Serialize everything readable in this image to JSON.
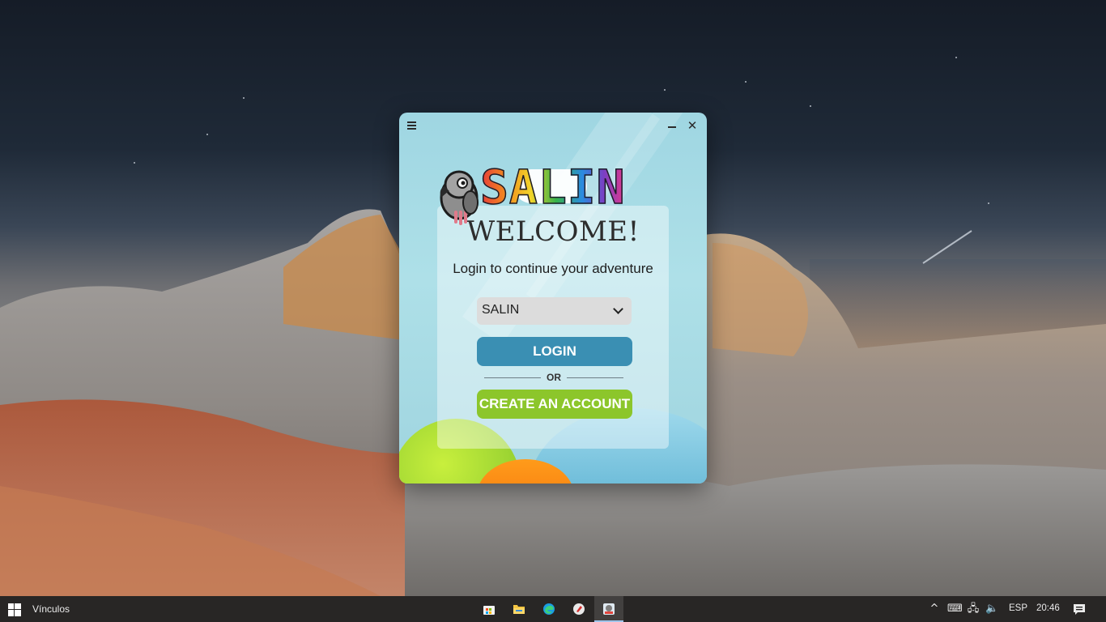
{
  "desktop": {
    "wallpaper": "desert-rock-night-sky"
  },
  "app": {
    "logo_text": "SALIN",
    "welcome_title": "WELCOME!",
    "subtitle": "Login to continue your adventure",
    "profile_select": {
      "selected": "SALIN"
    },
    "login_label": "LOGIN",
    "or_label": "OR",
    "create_label": "CREATE AN ACCOUNT",
    "colors": {
      "login_button": "#3a8fb3",
      "create_button": "#8cc62b",
      "window_bg": "#aee0e8"
    }
  },
  "taskbar": {
    "links_label": "Vínculos",
    "pinned_apps": [
      "store-icon",
      "file-explorer-icon",
      "edge-icon",
      "app-icon",
      "salin-app-icon"
    ],
    "language": "ESP",
    "time": "20:46"
  }
}
